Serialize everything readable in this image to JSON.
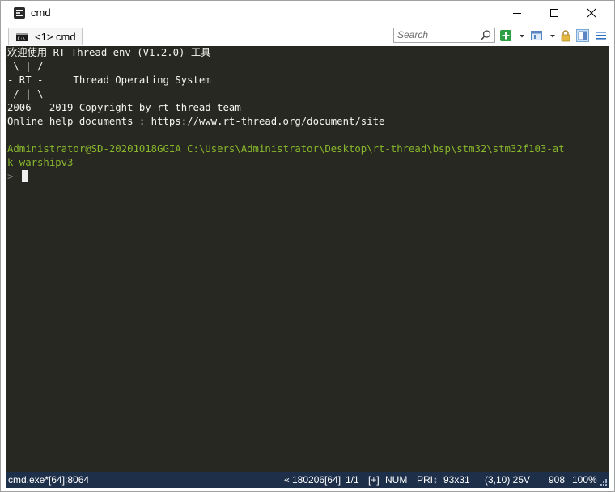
{
  "window": {
    "title": "cmd"
  },
  "tab": {
    "label": "<1> cmd"
  },
  "search": {
    "placeholder": "Search"
  },
  "console": {
    "lines": [
      "欢迎使用 RT-Thread env (V1.2.0) 工具",
      " \\ | /",
      "- RT -     Thread Operating System",
      " / | \\",
      "2006 - 2019 Copyright by rt-thread team",
      "Online help documents : https://www.rt-thread.org/document/site"
    ],
    "prompt_user": "Administrator@SD-20201018GGIA",
    "prompt_path_line1": "C:\\Users\\Administrator\\Desktop\\rt-thread\\bsp\\stm32\\stm32f103-at",
    "prompt_path_line2": "k-warshipv3",
    "prompt_symbol": ">"
  },
  "status": {
    "process": "cmd.exe*[64]:8064",
    "build": "« 180206[64]",
    "console_index": "1/1",
    "plus": "[+]",
    "num": "NUM",
    "pri": "PRI↕",
    "size": "93x31",
    "cursor_pos": "(3,10) 25V",
    "mem": "908",
    "zoom": "100%"
  },
  "colors": {
    "console_bg": "#272822",
    "console_fg": "#f5f5f0",
    "prompt_green": "#89b72c",
    "status_bg": "#1e2f4a"
  }
}
